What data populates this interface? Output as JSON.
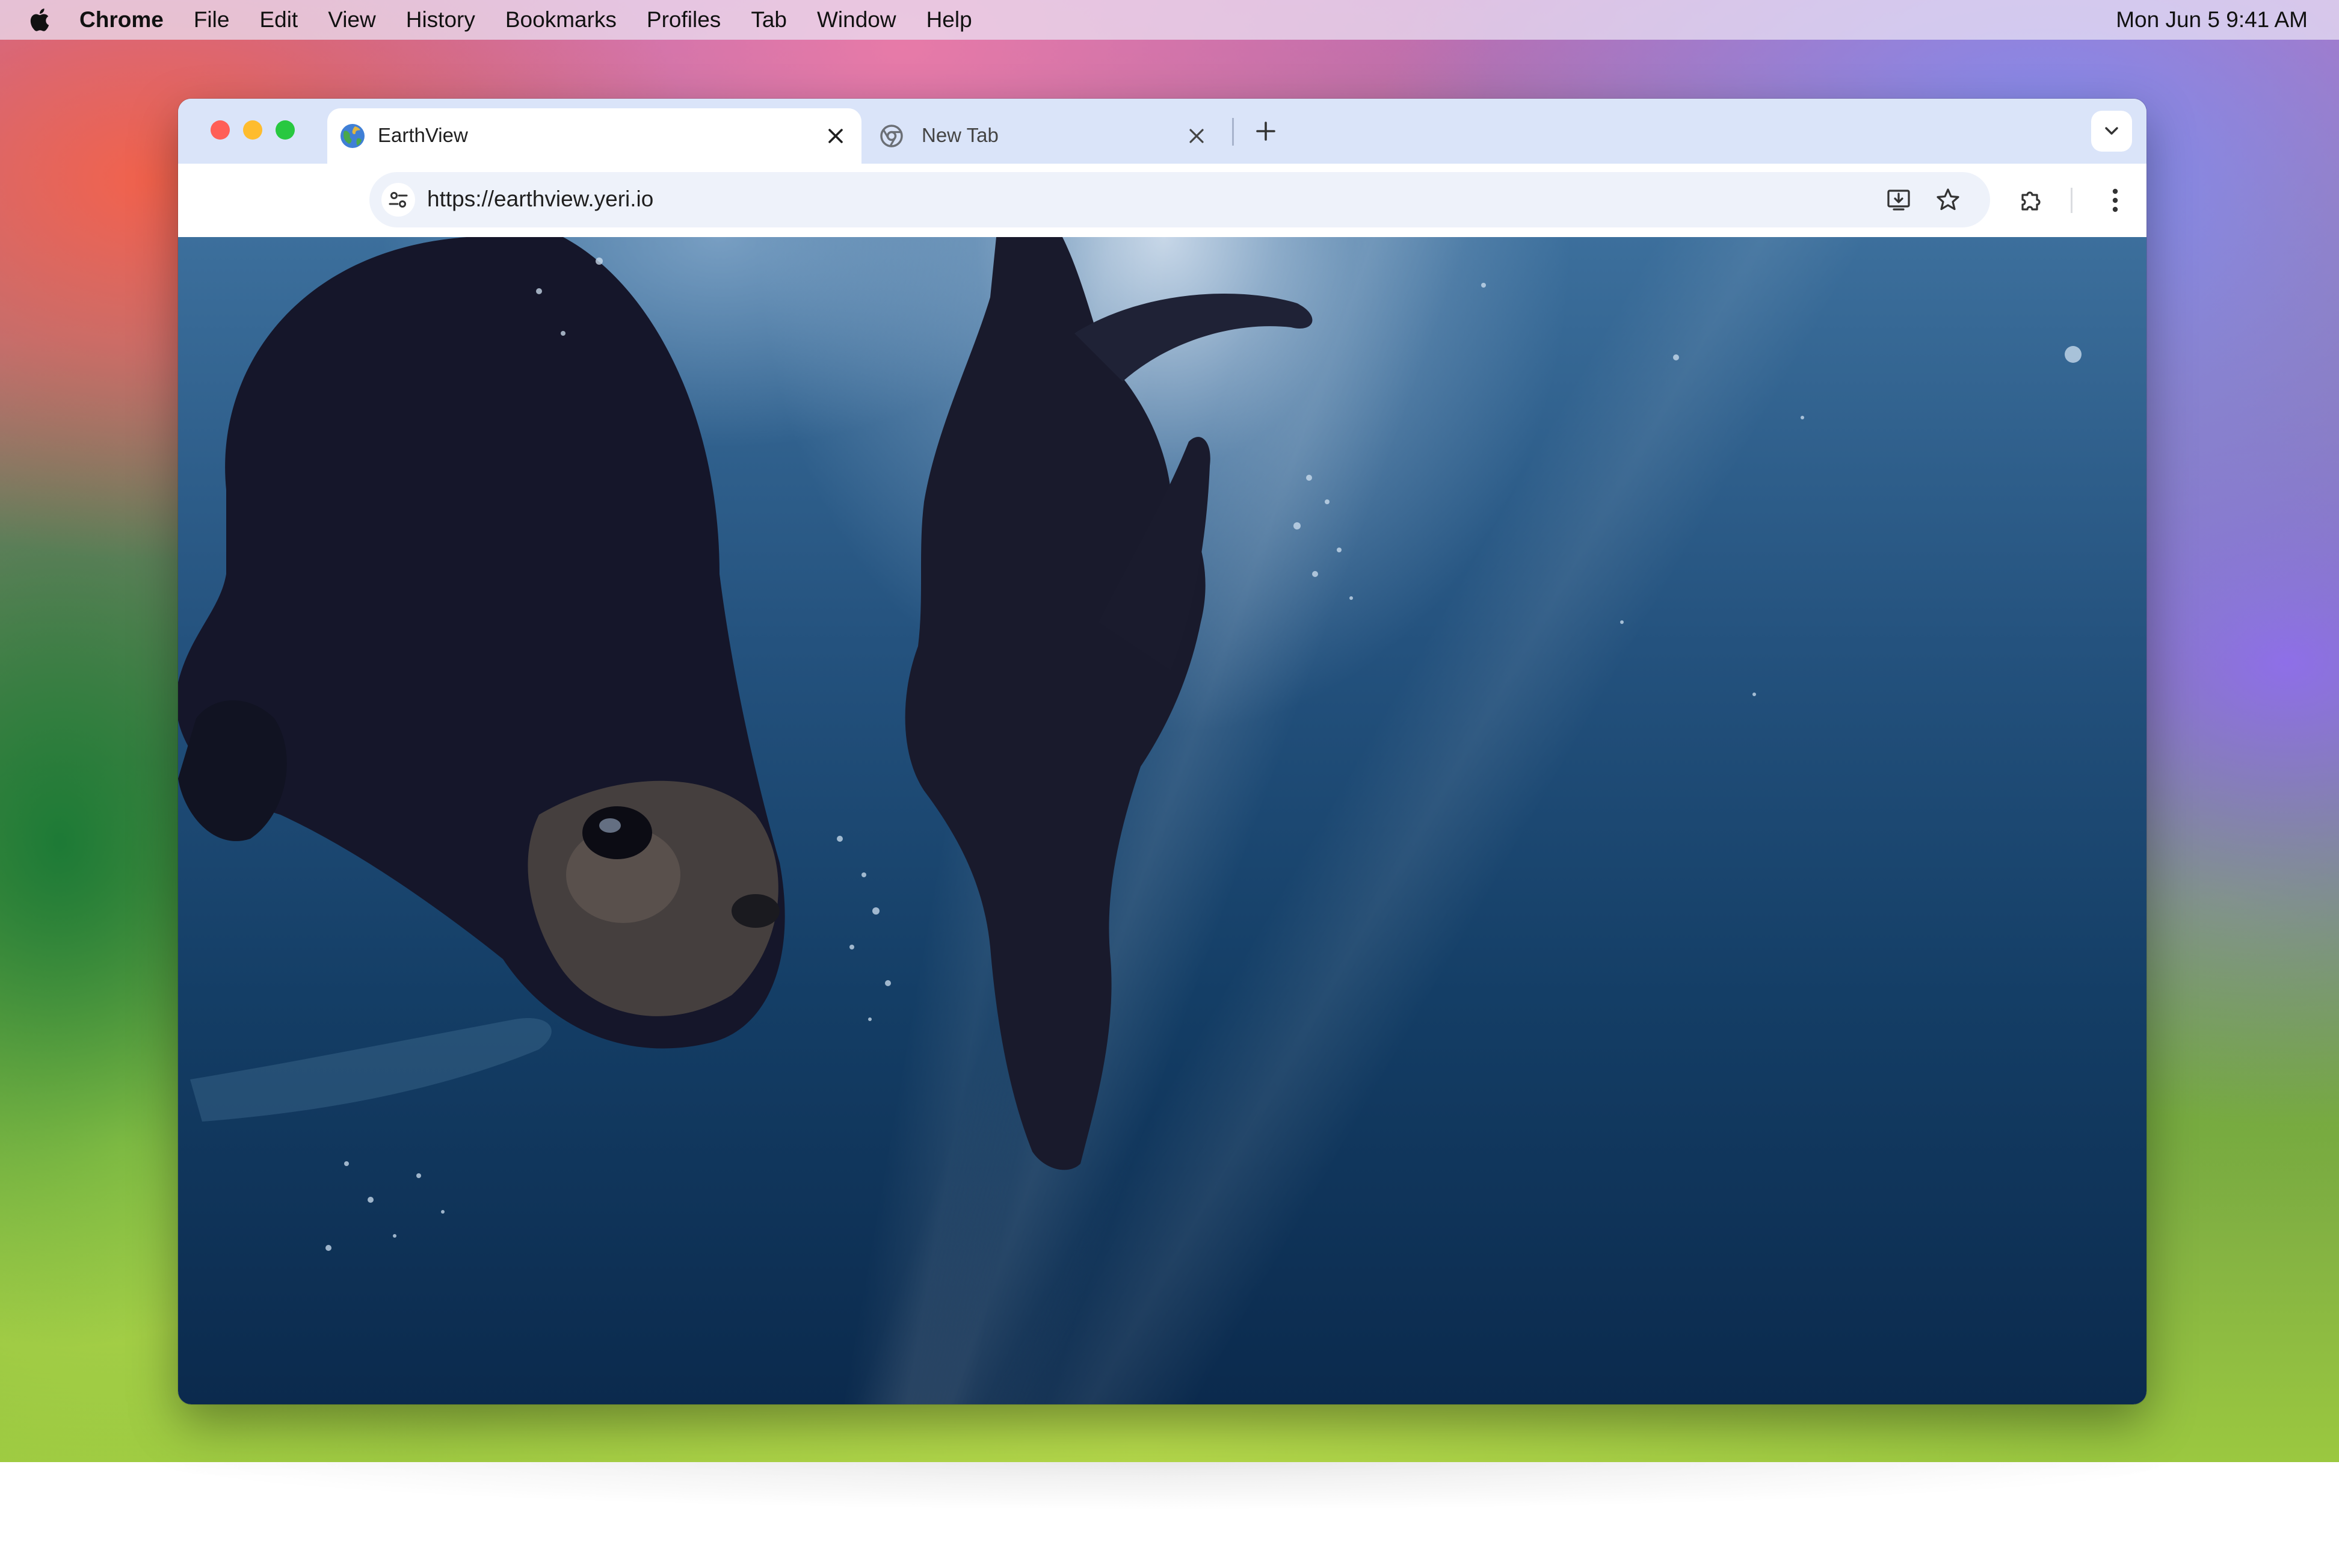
{
  "menubar": {
    "apple_icon": "apple-logo-icon",
    "app_name": "Chrome",
    "items": [
      "File",
      "Edit",
      "View",
      "History",
      "Bookmarks",
      "Profiles",
      "Tab",
      "Window",
      "Help"
    ],
    "clock": "Mon Jun 5  9:41 AM"
  },
  "browser": {
    "tabs": [
      {
        "title": "EarthView",
        "favicon": "globe-icon",
        "active": true
      },
      {
        "title": "New Tab",
        "favicon": "chrome-icon",
        "active": false
      }
    ],
    "address": {
      "url": "https://earthview.yeri.io"
    }
  },
  "page": {
    "image_subject": "sea lions swimming underwater"
  },
  "colors": {
    "tabstrip": "#dae4f9",
    "omnibox": "#eef2fa",
    "close": "#ff5f57",
    "minimize": "#febc2e",
    "zoom": "#28c840"
  }
}
